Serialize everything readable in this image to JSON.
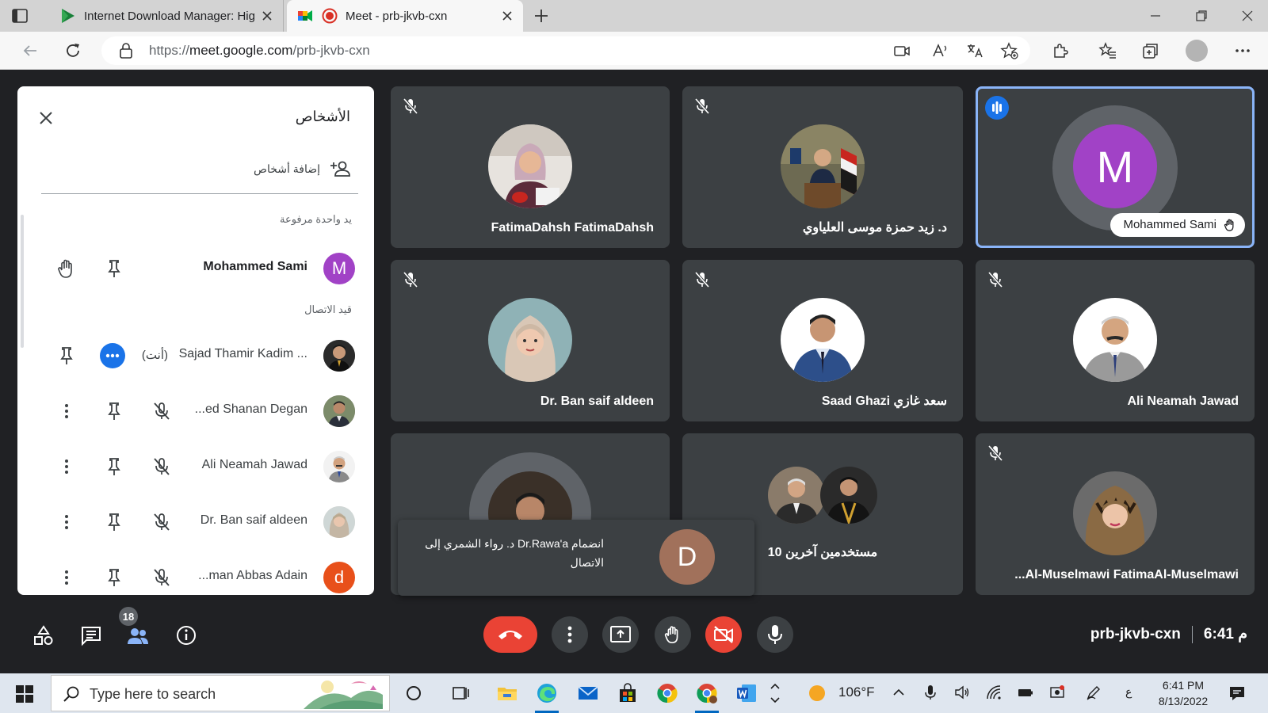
{
  "browser": {
    "tabs": [
      {
        "title": "Internet Download Manager: Hig",
        "active": false,
        "icon": "idm-play-icon"
      },
      {
        "title": "Meet - prb-jkvb-cxn",
        "active": true,
        "icon": "google-meet-icon"
      }
    ],
    "url": {
      "scheme": "https://",
      "host": "meet.google.com",
      "path": "/prb-jkvb-cxn"
    }
  },
  "people_panel": {
    "title": "الأشخاص",
    "add_people_label": "إضافة أشخاص",
    "raised_hands_label": "يد واحدة مرفوعة",
    "in_call_label": "قيد الاتصال",
    "raised": [
      {
        "name": "Mohammed Sami",
        "initial": "M",
        "color": "#a142c6"
      }
    ],
    "in_call": [
      {
        "name": "Sajad Thamir Kadim ...",
        "you_label": "(أنت)",
        "muted": false
      },
      {
        "name": "...ed Shanan Degan",
        "muted": true
      },
      {
        "name": "Ali Neamah Jawad",
        "muted": true
      },
      {
        "name": "Dr. Ban saif aldeen",
        "muted": true
      },
      {
        "name": "...man Abbas Adain",
        "initial": "d",
        "color": "#e8501a",
        "muted": true
      }
    ]
  },
  "tiles": [
    {
      "name": "FatimaDahsh FatimaDahsh",
      "muted": true
    },
    {
      "name": "د. زيد حمزة موسى العلياوي",
      "muted": true
    },
    {
      "name": "Mohammed Sami",
      "initial": "M",
      "speaking": true,
      "hand_raised": true,
      "color": "#a142c6"
    },
    {
      "name": "Dr. Ban saif aldeen",
      "muted": true
    },
    {
      "name": "Saad Ghazi سعد غازي",
      "muted": true
    },
    {
      "name": "Ali Neamah Jawad",
      "muted": true
    },
    {
      "name": "",
      "muted": false
    },
    {
      "name": "10 مستخدمين آخرين",
      "muted": false
    },
    {
      "name": "...Al-Muselmawi FatimaAl-Muselmawi",
      "muted": true
    }
  ],
  "toast": {
    "text": "انضمام Dr.Rawa'a د. رواء الشمري إلى الاتصال",
    "initial": "D",
    "color": "#a1715b"
  },
  "controls": {
    "people_count": "18",
    "meeting_code": "prb-jkvb-cxn",
    "time": "6:41 م",
    "buttons": [
      "end-call",
      "more-options",
      "present",
      "raise-hand",
      "camera-off",
      "microphone"
    ]
  },
  "taskbar": {
    "search_placeholder": "Type here to search",
    "weather": "106°F",
    "language": "ع",
    "clock_time": "6:41 PM",
    "clock_date": "8/13/2022"
  },
  "colors": {
    "meet_background": "#202124",
    "tile_background": "#3c4043",
    "accent_blue": "#1a73e8",
    "end_call_red": "#ea4335"
  }
}
